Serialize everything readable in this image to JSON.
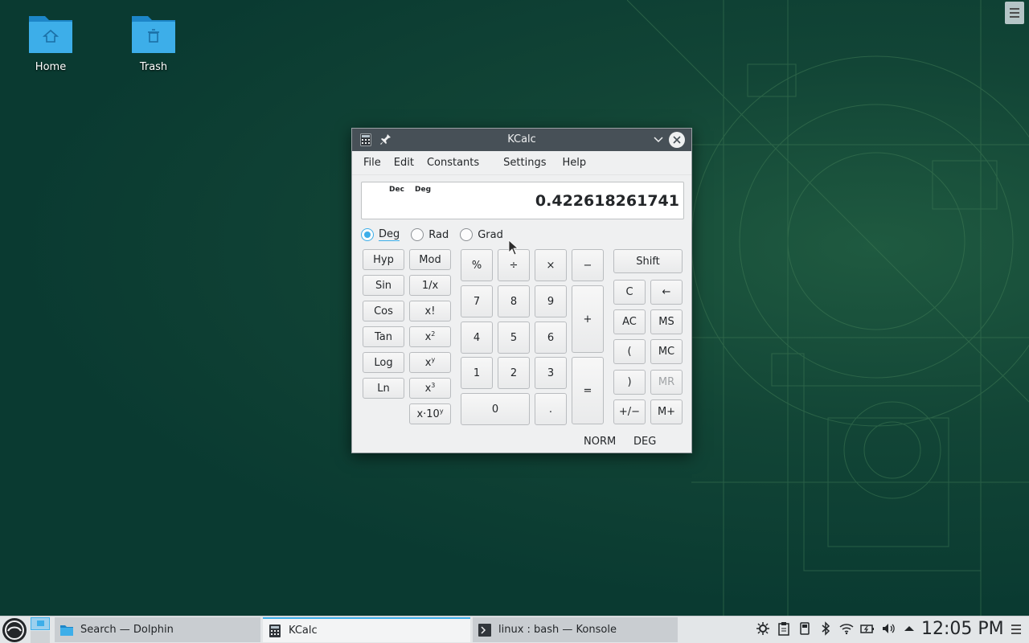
{
  "desktop": {
    "icons": [
      {
        "label": "Home",
        "icon": "home-folder-icon"
      },
      {
        "label": "Trash",
        "icon": "trash-folder-icon"
      }
    ]
  },
  "kcalc": {
    "title": "KCalc",
    "menu": [
      "File",
      "Edit",
      "Constants",
      "Settings",
      "Help"
    ],
    "display": {
      "base_indicator": "Dec",
      "angle_indicator": "Deg",
      "value": "0.422618261741"
    },
    "angle_modes": [
      {
        "label": "Deg",
        "checked": true
      },
      {
        "label": "Rad",
        "checked": false
      },
      {
        "label": "Grad",
        "checked": false
      }
    ],
    "function_buttons": {
      "hyp": "Hyp",
      "mod": "Mod",
      "sin": "Sin",
      "reciprocal": "1/x",
      "cos": "Cos",
      "factorial": "x!",
      "tan": "Tan",
      "square_base": "x",
      "square_exp": "2",
      "log": "Log",
      "power_base": "x",
      "power_exp": "y",
      "ln": "Ln",
      "cube_base": "x",
      "cube_exp": "3",
      "exp10_base": "x·10",
      "exp10_exp": "y"
    },
    "numpad": {
      "percent": "%",
      "divide": "÷",
      "multiply": "×",
      "minus": "−",
      "seven": "7",
      "eight": "8",
      "nine": "9",
      "plus": "+",
      "four": "4",
      "five": "5",
      "six": "6",
      "one": "1",
      "two": "2",
      "three": "3",
      "equals": "=",
      "zero": "0",
      "decimal": "."
    },
    "right_buttons": {
      "shift": "Shift",
      "clear": "C",
      "backspace": "←",
      "all_clear": "AC",
      "memory_store": "MS",
      "open_paren": "(",
      "memory_clear": "MC",
      "close_paren": ")",
      "memory_recall": "MR",
      "sign": "+/−",
      "memory_add": "M+"
    },
    "status": {
      "mode": "NORM",
      "angle": "DEG"
    }
  },
  "taskbar": {
    "tasks": [
      {
        "label": "Search — Dolphin",
        "icon": "dolphin-icon",
        "active": false
      },
      {
        "label": "KCalc",
        "icon": "kcalc-icon",
        "active": true
      },
      {
        "label": "linux : bash — Konsole",
        "icon": "konsole-icon",
        "active": false
      }
    ],
    "clock": "12:05 PM"
  },
  "colors": {
    "accent": "#3daee9",
    "titlebar": "#475057",
    "window_bg": "#eff0f1",
    "desktop_bg": "#0b3a32"
  }
}
